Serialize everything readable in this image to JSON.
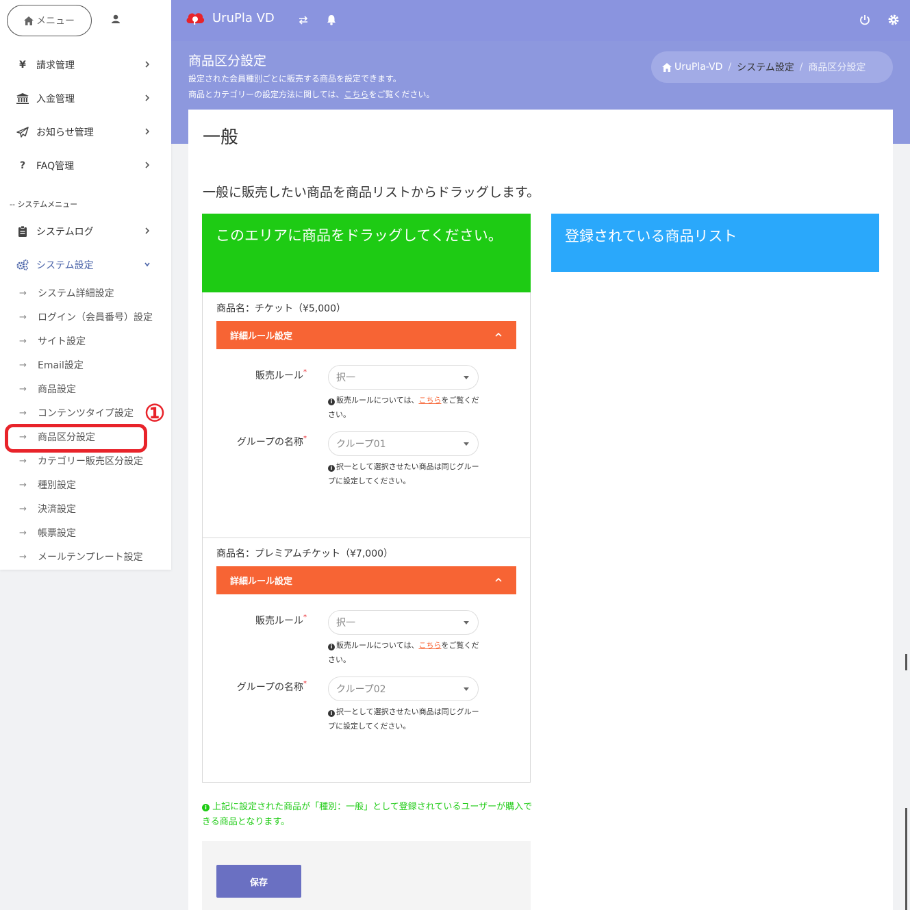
{
  "sidebar": {
    "menu_button": "メニュー",
    "items": [
      {
        "label": "請求管理",
        "icon": "yen-icon"
      },
      {
        "label": "入金管理",
        "icon": "bank-icon"
      },
      {
        "label": "お知らせ管理",
        "icon": "paper-plane-icon"
      },
      {
        "label": "FAQ管理",
        "icon": "question-icon"
      }
    ],
    "section_label": "-- システムメニュー",
    "system_items": [
      {
        "label": "システムログ",
        "icon": "clipboard-icon"
      },
      {
        "label": "システム設定",
        "icon": "gears-icon",
        "expanded": true
      }
    ],
    "sub_items": [
      "システム詳細設定",
      "ログイン（会員番号）設定",
      "サイト設定",
      "Email設定",
      "商品設定",
      "コンテンツタイプ設定",
      "商品区分設定",
      "カテゴリー販売区分設定",
      "種別設定",
      "決済設定",
      "帳票設定",
      "メールテンプレート設定"
    ],
    "annotation_number": "①",
    "arrow": "→"
  },
  "header": {
    "brand": "UruPla VD",
    "colors": {
      "topbar": "#8a94df",
      "accent_red": "#e8232a"
    }
  },
  "page": {
    "title": "商品区分設定",
    "desc1": "設定された会員種別ごとに販売する商品を設定できます。",
    "desc2_before": "商品とカテゴリーの設定方法に関しては、",
    "desc2_link": "こちら",
    "desc2_after": "をご覧ください。",
    "breadcrumb": [
      "UruPla-VD",
      "システム設定",
      "商品区分設定"
    ],
    "breadcrumb_sep": "/"
  },
  "card": {
    "title": "一般",
    "lead": "一般に販売したい商品を商品リストからドラッグします。",
    "drop_title": "このエリアに商品をドラッグしてください。",
    "list_title": "登録されている商品リスト",
    "products": [
      {
        "name": "商品名：チケット（¥5,000）",
        "rule_bar": "詳細ルール設定",
        "sale_rule_label": "販売ルール",
        "sale_rule_value": "択一",
        "sale_help_before": "販売ルールについては、",
        "sale_help_link": "こちら",
        "sale_help_after": "をご覧ください。",
        "group_label": "グループの名称",
        "group_value": "クループ01",
        "group_help": "択一として選択させたい商品は同じグループに設定してください。"
      },
      {
        "name": "商品名：プレミアムチケット（¥7,000）",
        "rule_bar": "詳細ルール設定",
        "sale_rule_label": "販売ルール",
        "sale_rule_value": "択一",
        "sale_help_before": "販売ルールについては、",
        "sale_help_link": "こちら",
        "sale_help_after": "をご覧ください。",
        "group_label": "グループの名称",
        "group_value": "クループ02",
        "group_help": "択一として選択させたい商品は同じグループに設定してください。"
      }
    ],
    "required_mark": "*",
    "note": "上記に設定された商品が「種別：一般」として登録されているユーザーが購入できる商品となります。",
    "save_button": "保存"
  }
}
